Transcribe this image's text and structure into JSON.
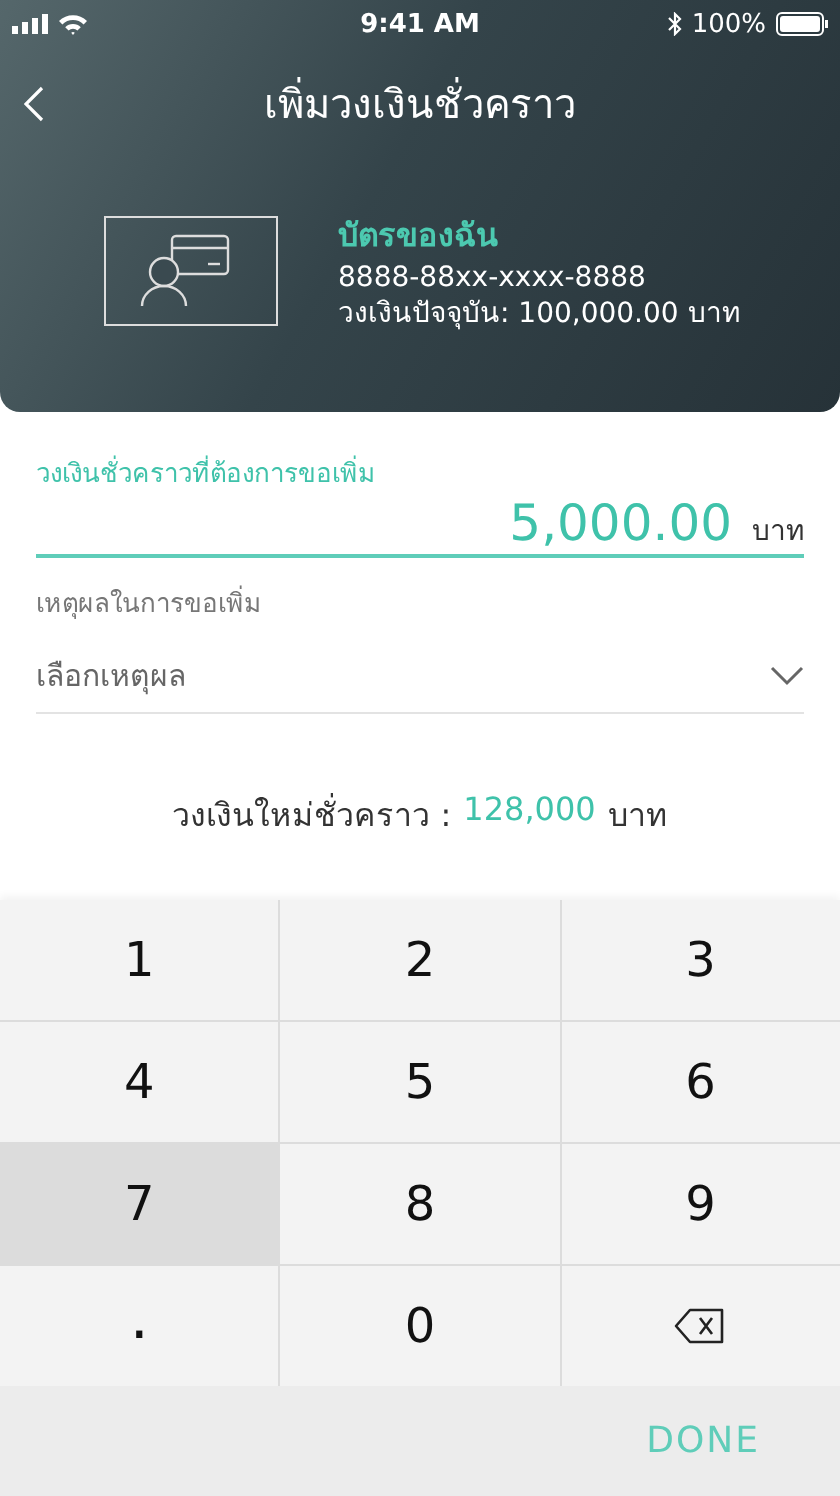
{
  "status_bar": {
    "time": "9:41 AM",
    "battery": "100%"
  },
  "header": {
    "title": "เพิ่มวงเงินชั่วคราว"
  },
  "card": {
    "name": "บัตรของฉัน",
    "number": "8888-88xx-xxxx-8888",
    "limit": "วงเงินปัจจุบัน: 100,000.00 บาท"
  },
  "amount_field": {
    "label": "วงเงินชั่วคราวที่ต้องการขอเพิ่ม",
    "value": "5,000.00",
    "unit": "บาท"
  },
  "reason_field": {
    "label": "เหตุผลในการขอเพิ่ม",
    "placeholder": "เลือกเหตุผล"
  },
  "new_limit": {
    "label": "วงเงินใหม่ชั่วคราว :",
    "value": "128,000",
    "unit": "บาท"
  },
  "keypad": {
    "keys": [
      {
        "kind": "digit",
        "label": "1",
        "selected": false
      },
      {
        "kind": "digit",
        "label": "2",
        "selected": false
      },
      {
        "kind": "digit",
        "label": "3",
        "selected": false
      },
      {
        "kind": "digit",
        "label": "4",
        "selected": false
      },
      {
        "kind": "digit",
        "label": "5",
        "selected": false
      },
      {
        "kind": "digit",
        "label": "6",
        "selected": false
      },
      {
        "kind": "digit",
        "label": "7",
        "selected": true
      },
      {
        "kind": "digit",
        "label": "8",
        "selected": false
      },
      {
        "kind": "digit",
        "label": "9",
        "selected": false
      },
      {
        "kind": "digit",
        "label": ".",
        "selected": false
      },
      {
        "kind": "digit",
        "label": "0",
        "selected": false
      },
      {
        "kind": "backspace",
        "selected": false
      }
    ],
    "done": "DONE"
  }
}
